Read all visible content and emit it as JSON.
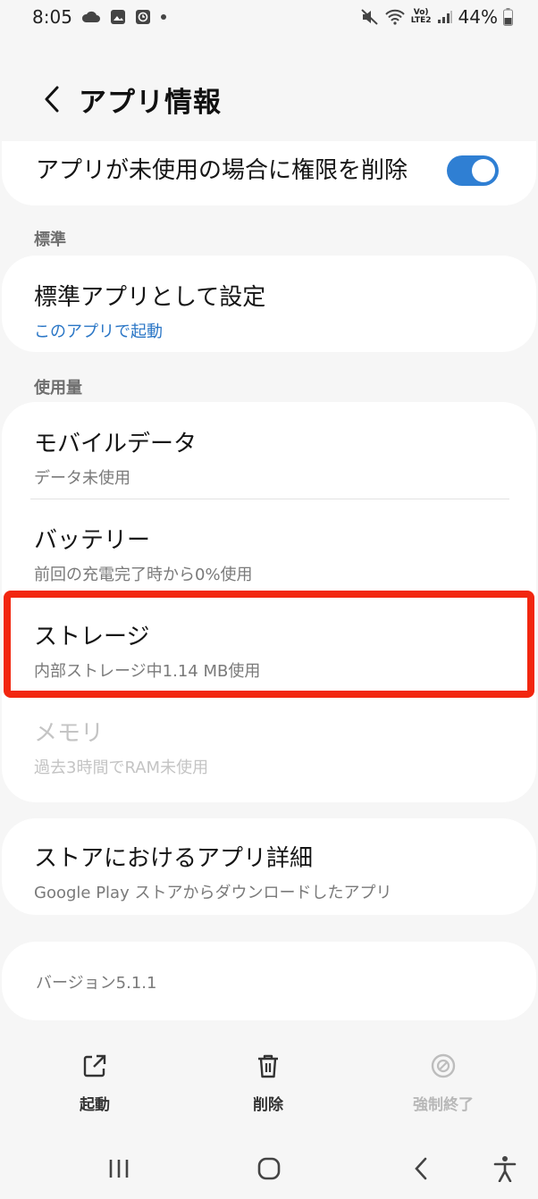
{
  "status": {
    "time": "8:05",
    "battery": "44%",
    "net": "Vo)\nLTE2"
  },
  "header": {
    "title": "アプリ情報"
  },
  "permission": {
    "label": "アプリが未使用の場合に権限を削除",
    "enabled": true
  },
  "sections": {
    "default_label": "標準",
    "usage_label": "使用量"
  },
  "default_app": {
    "title": "標準アプリとして設定",
    "sub": "このアプリで起動"
  },
  "usage": [
    {
      "title": "モバイルデータ",
      "sub": "データ未使用"
    },
    {
      "title": "バッテリー",
      "sub": "前回の充電完了時から0%使用"
    },
    {
      "title": "ストレージ",
      "sub": "内部ストレージ中1.14 MB使用"
    },
    {
      "title": "メモリ",
      "sub": "過去3時間でRAM未使用"
    }
  ],
  "store": {
    "title": "ストアにおけるアプリ詳細",
    "sub": "Google Play ストアからダウンロードしたアプリ"
  },
  "version": "バージョン5.1.1",
  "actions": {
    "open": "起動",
    "uninstall": "削除",
    "force_stop": "強制終了"
  },
  "colors": {
    "accent": "#2f7fd3",
    "highlight": "#f2260f",
    "link": "#2a76c6"
  }
}
